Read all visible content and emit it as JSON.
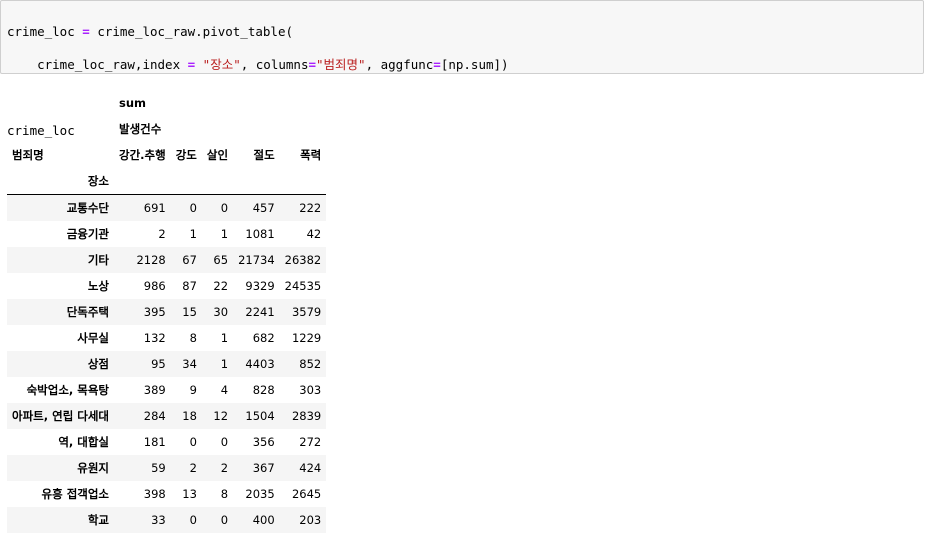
{
  "code": {
    "line1": {
      "a": "crime_loc ",
      "op": "=",
      "b": " crime_loc_raw.pivot_table("
    },
    "line2": {
      "a": "    crime_loc_raw,index ",
      "op1": "=",
      "s1": " \"장소\"",
      "c": ", columns",
      "op2": "=",
      "s2": "\"범죄명\"",
      "d": ", aggfunc",
      "op3": "=",
      "e": "[np.sum])"
    },
    "line3": "",
    "line4": "crime_loc"
  },
  "table": {
    "header": {
      "level0": "sum",
      "level1": "발생건수",
      "columns_name": "범죄명",
      "columns": [
        "강간.추행",
        "강도",
        "살인",
        "절도",
        "폭력"
      ],
      "index_name": "장소"
    },
    "rows": [
      {
        "index": "교통수단",
        "values": [
          "691",
          "0",
          "0",
          "457",
          "222"
        ]
      },
      {
        "index": "금융기관",
        "values": [
          "2",
          "1",
          "1",
          "1081",
          "42"
        ]
      },
      {
        "index": "기타",
        "values": [
          "2128",
          "67",
          "65",
          "21734",
          "26382"
        ]
      },
      {
        "index": "노상",
        "values": [
          "986",
          "87",
          "22",
          "9329",
          "24535"
        ]
      },
      {
        "index": "단독주택",
        "values": [
          "395",
          "15",
          "30",
          "2241",
          "3579"
        ]
      },
      {
        "index": "사무실",
        "values": [
          "132",
          "8",
          "1",
          "682",
          "1229"
        ]
      },
      {
        "index": "상점",
        "values": [
          "95",
          "34",
          "1",
          "4403",
          "852"
        ]
      },
      {
        "index": "숙박업소, 목욕탕",
        "values": [
          "389",
          "9",
          "4",
          "828",
          "303"
        ]
      },
      {
        "index": "아파트, 연립 다세대",
        "values": [
          "284",
          "18",
          "12",
          "1504",
          "2839"
        ]
      },
      {
        "index": "역, 대합실",
        "values": [
          "181",
          "0",
          "0",
          "356",
          "272"
        ]
      },
      {
        "index": "유원지",
        "values": [
          "59",
          "2",
          "2",
          "367",
          "424"
        ]
      },
      {
        "index": "유흥 접객업소",
        "values": [
          "398",
          "13",
          "8",
          "2035",
          "2645"
        ]
      },
      {
        "index": "학교",
        "values": [
          "33",
          "0",
          "0",
          "400",
          "203"
        ]
      }
    ]
  }
}
